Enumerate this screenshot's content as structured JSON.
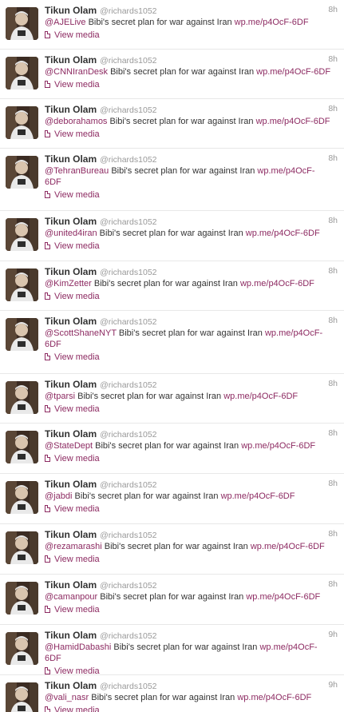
{
  "colors": {
    "link": "#8d2b62",
    "meta": "#999999",
    "text": "#333333",
    "divider": "#e8e8e8"
  },
  "tweets": [
    {
      "fullname": "Tikun Olam",
      "screen_name": "@richards1052",
      "time": "8h",
      "mention": "@AJELive",
      "text": " Bibi's secret plan for war against Iran ",
      "link": "wp.me/p4OcF-6DF",
      "media_label": "View media",
      "media_icon": "document-icon"
    },
    {
      "fullname": "Tikun Olam",
      "screen_name": "@richards1052",
      "time": "8h",
      "mention": "@CNNIranDesk",
      "text": " Bibi's secret plan for war against Iran ",
      "link": "wp.me/p4OcF-6DF",
      "media_label": "View media",
      "media_icon": "document-icon"
    },
    {
      "fullname": "Tikun Olam",
      "screen_name": "@richards1052",
      "time": "8h",
      "mention": "@deborahamos",
      "text": " Bibi's secret plan for war against Iran ",
      "link": "wp.me/p4OcF-6DF",
      "media_label": "View media",
      "media_icon": "document-icon"
    },
    {
      "fullname": "Tikun Olam",
      "screen_name": "@richards1052",
      "time": "8h",
      "mention": "@TehranBureau",
      "text": " Bibi's secret plan for war against Iran ",
      "link": "wp.me/p4OcF-6DF",
      "media_label": "View media",
      "media_icon": "document-icon"
    },
    {
      "fullname": "Tikun Olam",
      "screen_name": "@richards1052",
      "time": "8h",
      "mention": "@united4iran",
      "text": " Bibi's secret plan for war against Iran ",
      "link": "wp.me/p4OcF-6DF",
      "media_label": "View media",
      "media_icon": "document-icon"
    },
    {
      "fullname": "Tikun Olam",
      "screen_name": "@richards1052",
      "time": "8h",
      "mention": "@KimZetter",
      "text": " Bibi's secret plan for war against Iran ",
      "link": "wp.me/p4OcF-6DF",
      "media_label": "View media",
      "media_icon": "document-icon"
    },
    {
      "fullname": "Tikun Olam",
      "screen_name": "@richards1052",
      "time": "8h",
      "mention": "@ScottShaneNYT",
      "text": " Bibi's secret plan for war against Iran ",
      "link": "wp.me/p4OcF-6DF",
      "media_label": "View media",
      "media_icon": "document-icon"
    },
    {
      "fullname": "Tikun Olam",
      "screen_name": "@richards1052",
      "time": "8h",
      "mention": "@tparsi",
      "text": " Bibi's secret plan for war against Iran ",
      "link": "wp.me/p4OcF-6DF",
      "media_label": "View media",
      "media_icon": "document-icon"
    },
    {
      "fullname": "Tikun Olam",
      "screen_name": "@richards1052",
      "time": "8h",
      "mention": "@StateDept",
      "text": " Bibi's secret plan for war against Iran ",
      "link": "wp.me/p4OcF-6DF",
      "media_label": "View media",
      "media_icon": "document-icon"
    },
    {
      "fullname": "Tikun Olam",
      "screen_name": "@richards1052",
      "time": "8h",
      "mention": "@jabdi",
      "text": " Bibi's secret plan for war against Iran ",
      "link": "wp.me/p4OcF-6DF",
      "media_label": "View media",
      "media_icon": "document-icon"
    },
    {
      "fullname": "Tikun Olam",
      "screen_name": "@richards1052",
      "time": "8h",
      "mention": "@rezamarashi",
      "text": " Bibi's secret plan for war against Iran ",
      "link": "wp.me/p4OcF-6DF",
      "media_label": "View media",
      "media_icon": "document-icon"
    },
    {
      "fullname": "Tikun Olam",
      "screen_name": "@richards1052",
      "time": "8h",
      "mention": "@camanpour",
      "text": " Bibi's secret plan for war against Iran ",
      "link": "wp.me/p4OcF-6DF",
      "media_label": "View media",
      "media_icon": "document-icon"
    },
    {
      "fullname": "Tikun Olam",
      "screen_name": "@richards1052",
      "time": "9h",
      "mention": "@HamidDabashi",
      "text": " Bibi's secret plan for war against Iran ",
      "link": "wp.me/p4OcF-6DF",
      "media_label": "View media",
      "media_icon": "document-icon"
    },
    {
      "fullname": "Tikun Olam",
      "screen_name": "@richards1052",
      "time": "9h",
      "mention": "@vali_nasr",
      "text": " Bibi's secret plan for war against Iran ",
      "link": "wp.me/p4OcF-6DF",
      "media_label": "View media",
      "media_icon": "document-icon"
    }
  ]
}
